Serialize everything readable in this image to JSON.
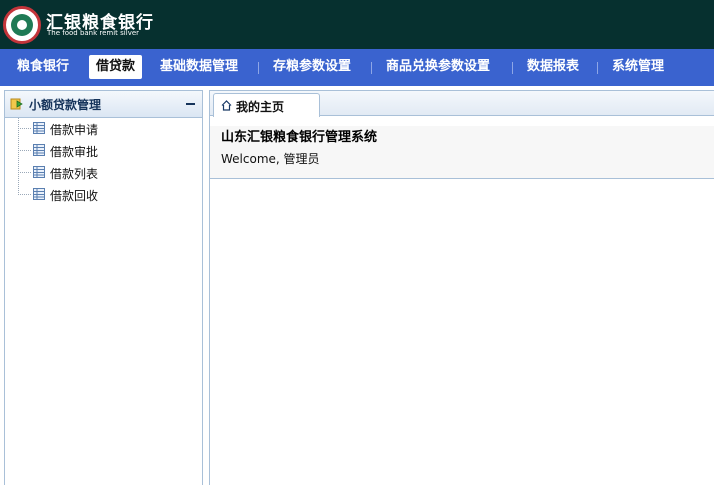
{
  "header": {
    "logo_name": "汇银粮食银行",
    "logo_subtitle": "The food bank remit silver",
    "logo_icon": "bank-seal-icon"
  },
  "nav": {
    "items": [
      {
        "label": "粮食银行",
        "active": false
      },
      {
        "label": "借贷款",
        "active": true
      },
      {
        "label": "基础数据管理",
        "active": false
      },
      {
        "label": "存粮参数设置",
        "active": false
      },
      {
        "label": "商品兑换参数设置",
        "active": false
      },
      {
        "label": "数据报表",
        "active": false
      },
      {
        "label": "系统管理",
        "active": false
      }
    ]
  },
  "sidebar": {
    "title": "小额贷款管理",
    "items": [
      {
        "label": "借款申请",
        "icon": "table-icon"
      },
      {
        "label": "借款审批",
        "icon": "table-icon"
      },
      {
        "label": "借款列表",
        "icon": "table-icon"
      },
      {
        "label": "借款回收",
        "icon": "table-icon"
      }
    ]
  },
  "main": {
    "tab_label": "我的主页",
    "system_title": "山东汇银粮食银行管理系统",
    "welcome_text": "Welcome, 管理员"
  },
  "colors": {
    "header_bg": "#06302f",
    "nav_bg": "#3a63cf",
    "border": "#a9c0d8"
  }
}
